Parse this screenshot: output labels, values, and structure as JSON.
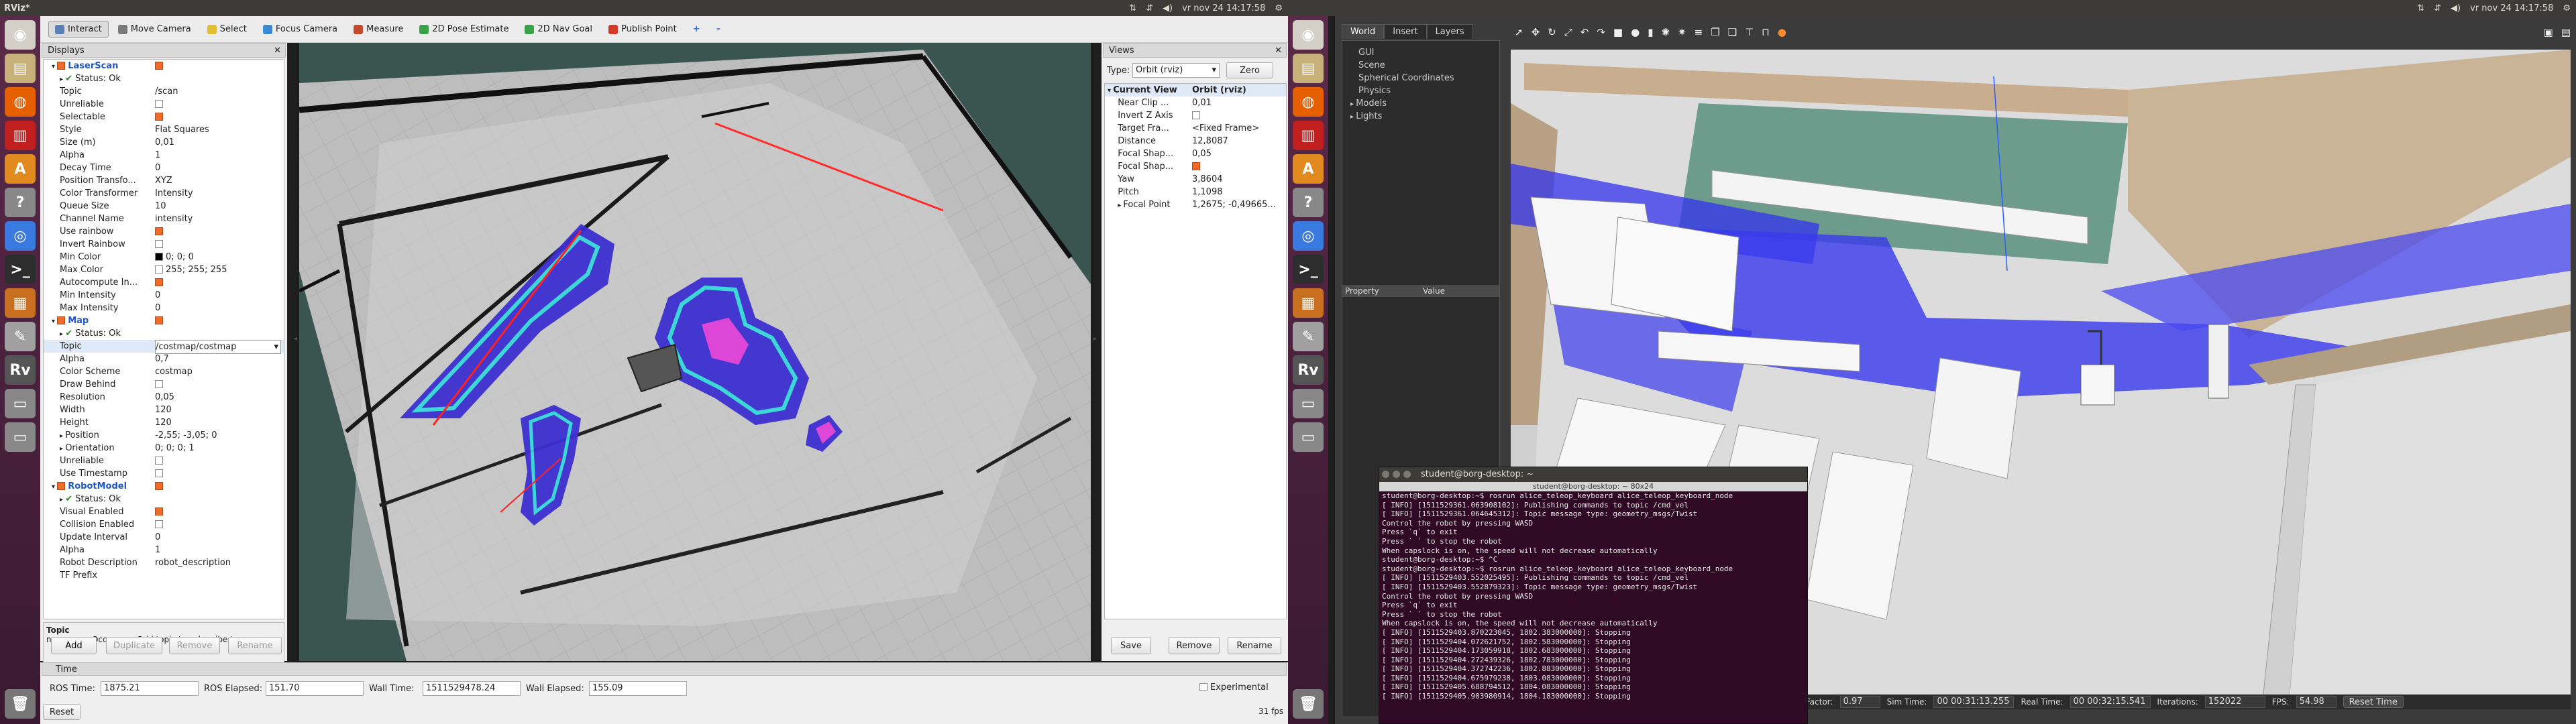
{
  "top_left": {
    "title": "RViz*",
    "date": "vr nov 24 14:17:58"
  },
  "top_right": {
    "date": "vr nov 24 14:17:58"
  },
  "launcher_icons": [
    "ubuntu-icon",
    "files-icon",
    "firefox-icon",
    "libreoffice-icon",
    "software-icon",
    "help-icon",
    "chrome-icon",
    "terminal-icon",
    "package-icon",
    "text-editor-icon",
    "rviz-icon",
    "drive-icon",
    "drive-icon",
    "trash-icon"
  ],
  "toolbar": {
    "tools": [
      {
        "name": "interact",
        "label": "Interact",
        "active": true,
        "color": "#5a7fb5"
      },
      {
        "name": "move-camera",
        "label": "Move Camera",
        "color": "#7a7a7a"
      },
      {
        "name": "select",
        "label": "Select",
        "color": "#e0c030"
      },
      {
        "name": "focus-camera",
        "label": "Focus Camera",
        "color": "#3a8ad4"
      },
      {
        "name": "measure",
        "label": "Measure",
        "color": "#c24a2a"
      },
      {
        "name": "pose-estimate",
        "label": "2D Pose Estimate",
        "color": "#3aa34a"
      },
      {
        "name": "nav-goal",
        "label": "2D Nav Goal",
        "color": "#3aa34a"
      },
      {
        "name": "publish-point",
        "label": "Publish Point",
        "color": "#d43a2a"
      }
    ],
    "extra": [
      "+",
      "–"
    ]
  },
  "displays": {
    "header": "Displays",
    "rows": [
      {
        "indent": 1,
        "arrow": "▾",
        "check": true,
        "key": "LaserScan",
        "blue": true,
        "val": "cb-on"
      },
      {
        "indent": 2,
        "arrow": "▸",
        "tick": true,
        "key": "Status: Ok"
      },
      {
        "indent": 2,
        "key": "Topic",
        "val": "/scan"
      },
      {
        "indent": 2,
        "key": "Unreliable",
        "val": "cb-off"
      },
      {
        "indent": 2,
        "key": "Selectable",
        "val": "cb-on"
      },
      {
        "indent": 2,
        "key": "Style",
        "val": "Flat Squares"
      },
      {
        "indent": 2,
        "key": "Size (m)",
        "val": "0,01"
      },
      {
        "indent": 2,
        "key": "Alpha",
        "val": "1"
      },
      {
        "indent": 2,
        "key": "Decay Time",
        "val": "0"
      },
      {
        "indent": 2,
        "key": "Position Transfo...",
        "val": "XYZ"
      },
      {
        "indent": 2,
        "key": "Color Transformer",
        "val": "Intensity"
      },
      {
        "indent": 2,
        "key": "Queue Size",
        "val": "10"
      },
      {
        "indent": 2,
        "key": "Channel Name",
        "val": "intensity"
      },
      {
        "indent": 2,
        "key": "Use rainbow",
        "val": "cb-on"
      },
      {
        "indent": 2,
        "key": "Invert Rainbow",
        "val": "cb-off"
      },
      {
        "indent": 2,
        "key": "Min Color",
        "val": "0; 0; 0",
        "swatch": "#000000"
      },
      {
        "indent": 2,
        "key": "Max Color",
        "val": "255; 255; 255",
        "swatch": "#ffffff"
      },
      {
        "indent": 2,
        "key": "Autocompute In...",
        "val": "cb-on"
      },
      {
        "indent": 2,
        "key": "Min Intensity",
        "val": "0"
      },
      {
        "indent": 2,
        "key": "Max Intensity",
        "val": "0"
      },
      {
        "indent": 1,
        "arrow": "▾",
        "check": true,
        "key": "Map",
        "blue": true,
        "val": "cb-on"
      },
      {
        "indent": 2,
        "arrow": "▸",
        "tick": true,
        "key": "Status: Ok"
      },
      {
        "indent": 2,
        "key": "Topic",
        "val": "/costmap/costmap",
        "combo": true,
        "selected": true
      },
      {
        "indent": 2,
        "key": "Alpha",
        "val": "0,7"
      },
      {
        "indent": 2,
        "key": "Color Scheme",
        "val": "costmap"
      },
      {
        "indent": 2,
        "key": "Draw Behind",
        "val": "cb-off"
      },
      {
        "indent": 2,
        "key": "Resolution",
        "val": "0,05"
      },
      {
        "indent": 2,
        "key": "Width",
        "val": "120"
      },
      {
        "indent": 2,
        "key": "Height",
        "val": "120"
      },
      {
        "indent": 2,
        "arrow": "▸",
        "key": "Position",
        "val": "-2,55; -3,05; 0"
      },
      {
        "indent": 2,
        "arrow": "▸",
        "key": "Orientation",
        "val": "0; 0; 0; 1"
      },
      {
        "indent": 2,
        "key": "Unreliable",
        "val": "cb-off"
      },
      {
        "indent": 2,
        "key": "Use Timestamp",
        "val": "cb-off"
      },
      {
        "indent": 1,
        "arrow": "▾",
        "check": true,
        "key": "RobotModel",
        "blue": true,
        "val": "cb-on"
      },
      {
        "indent": 2,
        "arrow": "▸",
        "tick": true,
        "key": "Status: Ok"
      },
      {
        "indent": 2,
        "key": "Visual Enabled",
        "val": "cb-on"
      },
      {
        "indent": 2,
        "key": "Collision Enabled",
        "val": "cb-off"
      },
      {
        "indent": 2,
        "key": "Update Interval",
        "val": "0"
      },
      {
        "indent": 2,
        "key": "Alpha",
        "val": "1"
      },
      {
        "indent": 2,
        "key": "Robot Description",
        "val": "robot_description"
      },
      {
        "indent": 2,
        "key": "TF Prefix",
        "val": ""
      }
    ],
    "help_title": "Topic",
    "help_text": "nav_msgs::OccupancyGrid topic to subscribe to.",
    "buttons": {
      "add": "Add",
      "duplicate": "Duplicate",
      "remove": "Remove",
      "rename": "Rename"
    }
  },
  "views": {
    "header": "Views",
    "type_label": "Type:",
    "type_value": "Orbit (rviz)",
    "zero": "Zero",
    "current_key": "Current View",
    "current_val": "Orbit (rviz)",
    "rows": [
      {
        "key": "Near Clip ...",
        "val": "0,01"
      },
      {
        "key": "Invert Z Axis",
        "val": "cb-off"
      },
      {
        "key": "Target Fra...",
        "val": "<Fixed Frame>"
      },
      {
        "key": "Distance",
        "val": "12,8087"
      },
      {
        "key": "Focal Shap...",
        "val": "0,05"
      },
      {
        "key": "Focal Shap...",
        "val": "cb-on"
      },
      {
        "key": "Yaw",
        "val": "3,8604"
      },
      {
        "key": "Pitch",
        "val": "1,1098"
      },
      {
        "key": "Focal Point",
        "val": "1,2675; -0,49665...",
        "arrow": true
      }
    ],
    "buttons": {
      "save": "Save",
      "remove": "Remove",
      "rename": "Rename"
    }
  },
  "time": {
    "header": "Time",
    "ros_time_label": "ROS Time:",
    "ros_time": "1875.21",
    "ros_elapsed_label": "ROS Elapsed:",
    "ros_elapsed": "151.70",
    "wall_time_label": "Wall Time:",
    "wall_time": "1511529478.24",
    "wall_elapsed_label": "Wall Elapsed:",
    "wall_elapsed": "155.09",
    "experimental": "Experimental",
    "reset": "Reset",
    "fps": "31 fps"
  },
  "gazebo": {
    "tabs": [
      "World",
      "Insert",
      "Layers"
    ],
    "tree": [
      "GUI",
      "Scene",
      "Spherical Coordinates",
      "Physics",
      "Models",
      "Lights"
    ],
    "prop_col": "Property",
    "value_col": "Value",
    "status": {
      "factor_label": "Factor:",
      "factor": "0.97",
      "sim_label": "Sim Time:",
      "sim": "00 00:31:13.255",
      "real_label": "Real Time:",
      "real": "00 00:32:15.541",
      "iter_label": "Iterations:",
      "iter": "152022",
      "fps_label": "FPS:",
      "fps": "54.98",
      "reset": "Reset Time"
    }
  },
  "terminal": {
    "title": "student@borg-desktop: ~",
    "subtitle": "student@borg-desktop: ~ 80x24",
    "lines": [
      "student@borg-desktop:~$ rosrun alice_teleop_keyboard alice_teleop_keyboard_node",
      "[ INFO] [1511529361.063908102]: Publishing commands to topic /cmd_vel",
      "[ INFO] [1511529361.064645312]: Topic message type: geometry_msgs/Twist",
      "Control the robot by pressing WASD",
      "Press `q` to exit",
      "Press ` ` to stop the robot",
      "When capslock is on, the speed will not decrease automatically",
      "student@borg-desktop:~$ ^C",
      "student@borg-desktop:~$ rosrun alice_teleop_keyboard alice_teleop_keyboard_node",
      "[ INFO] [1511529403.552025495]: Publishing commands to topic /cmd_vel",
      "[ INFO] [1511529403.552879323]: Topic message type: geometry_msgs/Twist",
      "Control the robot by pressing WASD",
      "Press `q` to exit",
      "Press ` ` to stop the robot",
      "When capslock is on, the speed will not decrease automatically",
      "[ INFO] [1511529403.870223045, 1802.383000000]: Stopping",
      "[ INFO] [1511529404.072621752, 1802.583000000]: Stopping",
      "[ INFO] [1511529404.173059918, 1802.683000000]: Stopping",
      "[ INFO] [1511529404.272439326, 1802.783000000]: Stopping",
      "[ INFO] [1511529404.372742236, 1802.883000000]: Stopping",
      "[ INFO] [1511529404.675979238, 1803.083000000]: Stopping",
      "[ INFO] [1511529405.688794512, 1804.083000000]: Stopping",
      "[ INFO] [1511529405.903980914, 1804.183000000]: Stopping"
    ]
  },
  "colors": {
    "rviz_bg": "#3a5450",
    "grid": "#a4a4a4",
    "costmap_outer": "#3c30d0",
    "costmap_inner": "#36d8d8",
    "lethal": "#e040d8",
    "laser": "#ff2020"
  }
}
